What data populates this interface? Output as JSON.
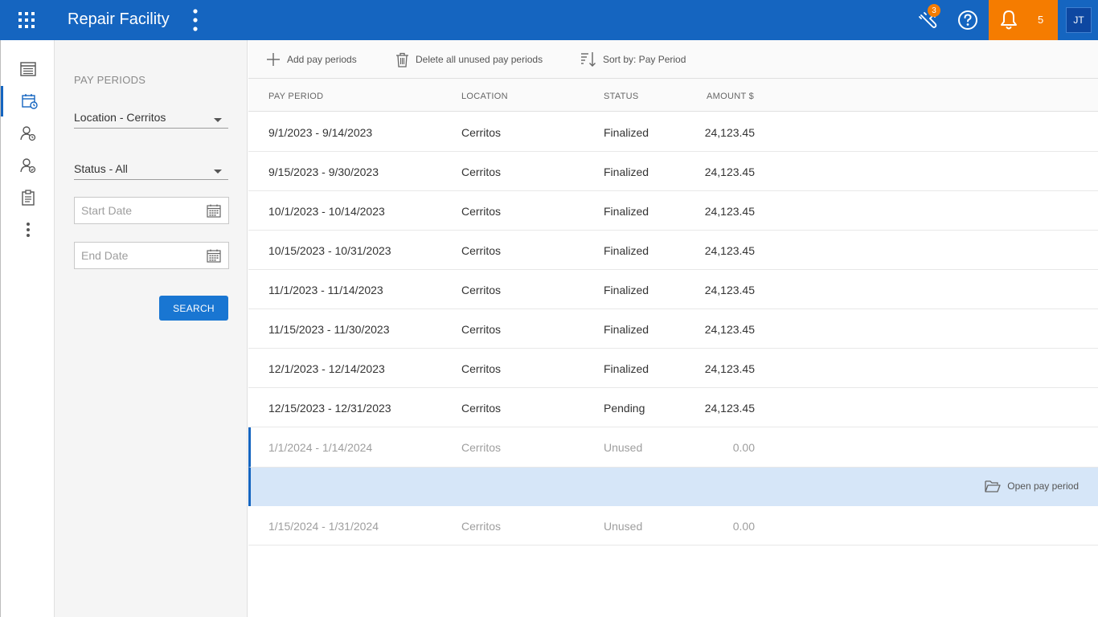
{
  "app": {
    "title": "Repair Facility"
  },
  "topbar": {
    "tools_badge": "3",
    "notifications_count": "5",
    "user_initials": "JT"
  },
  "filters": {
    "title": "PAY PERIODS",
    "location": "Location - Cerritos",
    "status": "Status - All",
    "start_date_placeholder": "Start Date",
    "end_date_placeholder": "End Date",
    "search_label": "SEARCH"
  },
  "toolbar": {
    "add": "Add pay periods",
    "delete": "Delete all unused pay periods",
    "sort": "Sort by: Pay Period"
  },
  "table": {
    "headers": {
      "period": "PAY PERIOD",
      "location": "LOCATION",
      "status": "STATUS",
      "amount": "AMOUNT $"
    },
    "rows": [
      {
        "period": "9/1/2023 - 9/14/2023",
        "location": "Cerritos",
        "status": "Finalized",
        "amount": "24,123.45"
      },
      {
        "period": "9/15/2023 - 9/30/2023",
        "location": "Cerritos",
        "status": "Finalized",
        "amount": "24,123.45"
      },
      {
        "period": "10/1/2023 - 10/14/2023",
        "location": "Cerritos",
        "status": "Finalized",
        "amount": "24,123.45"
      },
      {
        "period": "10/15/2023 - 10/31/2023",
        "location": "Cerritos",
        "status": "Finalized",
        "amount": "24,123.45"
      },
      {
        "period": "11/1/2023 - 11/14/2023",
        "location": "Cerritos",
        "status": "Finalized",
        "amount": "24,123.45"
      },
      {
        "period": "11/15/2023 - 11/30/2023",
        "location": "Cerritos",
        "status": "Finalized",
        "amount": "24,123.45"
      },
      {
        "period": "12/1/2023 - 12/14/2023",
        "location": "Cerritos",
        "status": "Finalized",
        "amount": "24,123.45"
      },
      {
        "period": "12/15/2023 - 12/31/2023",
        "location": "Cerritos",
        "status": "Pending",
        "amount": "24,123.45"
      },
      {
        "period": "1/1/2024 - 1/14/2024",
        "location": "Cerritos",
        "status": "Unused",
        "amount": "0.00"
      },
      {
        "period": "1/15/2024 - 1/31/2024",
        "location": "Cerritos",
        "status": "Unused",
        "amount": "0.00"
      }
    ],
    "open_action": "Open pay period"
  },
  "colors": {
    "primary": "#1565c0",
    "accent": "#f57c00",
    "selected_bg": "#d6e6f8"
  }
}
